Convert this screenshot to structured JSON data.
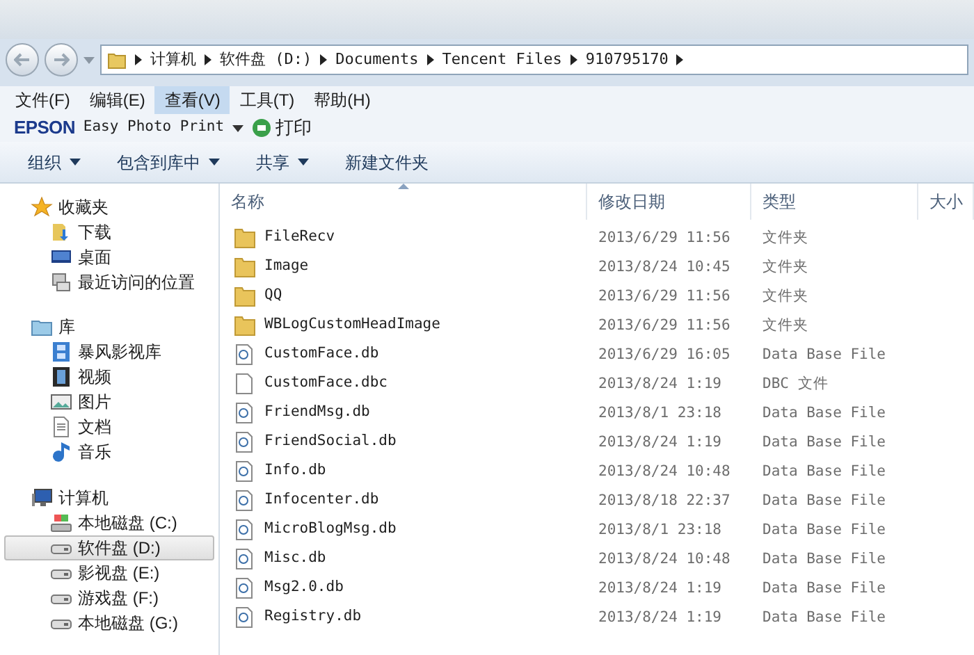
{
  "address_bar": {
    "path": [
      "计算机",
      "软件盘 (D:)",
      "Documents",
      "Tencent Files",
      "910795170"
    ]
  },
  "menu": [
    {
      "label": "文件(F)",
      "selected": false
    },
    {
      "label": "编辑(E)",
      "selected": false
    },
    {
      "label": "查看(V)",
      "selected": true
    },
    {
      "label": "工具(T)",
      "selected": false
    },
    {
      "label": "帮助(H)",
      "selected": false
    }
  ],
  "epson_bar": {
    "brand": "EPSON",
    "app": "Easy Photo Print",
    "print": "打印"
  },
  "toolbar": [
    "组织",
    "包含到库中",
    "共享",
    "新建文件夹"
  ],
  "sidebar": {
    "groups": [
      {
        "label": "收藏夹",
        "kind": "favorites",
        "children": [
          {
            "label": "下载",
            "kind": "download",
            "selected": false
          },
          {
            "label": "桌面",
            "kind": "desktop",
            "selected": false
          },
          {
            "label": "最近访问的位置",
            "kind": "recent",
            "selected": false
          }
        ]
      },
      {
        "label": "库",
        "kind": "library",
        "children": [
          {
            "label": "暴风影视库",
            "kind": "film",
            "selected": false
          },
          {
            "label": "视频",
            "kind": "video",
            "selected": false
          },
          {
            "label": "图片",
            "kind": "picture",
            "selected": false
          },
          {
            "label": "文档",
            "kind": "document",
            "selected": false
          },
          {
            "label": "音乐",
            "kind": "music",
            "selected": false
          }
        ]
      },
      {
        "label": "计算机",
        "kind": "computer",
        "children": [
          {
            "label": "本地磁盘 (C:)",
            "kind": "system-drive",
            "selected": false
          },
          {
            "label": "软件盘 (D:)",
            "kind": "drive",
            "selected": true
          },
          {
            "label": "影视盘 (E:)",
            "kind": "drive",
            "selected": false
          },
          {
            "label": "游戏盘 (F:)",
            "kind": "drive",
            "selected": false
          },
          {
            "label": "本地磁盘 (G:)",
            "kind": "drive",
            "selected": false
          }
        ]
      }
    ]
  },
  "table": {
    "columns": [
      "名称",
      "修改日期",
      "类型",
      "大小"
    ],
    "rows": [
      {
        "kind": "folder",
        "name": "FileRecv",
        "date": "2013/6/29 11:56",
        "type": "文件夹"
      },
      {
        "kind": "folder",
        "name": "Image",
        "date": "2013/8/24 10:45",
        "type": "文件夹"
      },
      {
        "kind": "folder",
        "name": "QQ",
        "date": "2013/6/29 11:56",
        "type": "文件夹"
      },
      {
        "kind": "folder",
        "name": "WBLogCustomHeadImage",
        "date": "2013/6/29 11:56",
        "type": "文件夹"
      },
      {
        "kind": "db",
        "name": "CustomFace.db",
        "date": "2013/6/29 16:05",
        "type": "Data Base File"
      },
      {
        "kind": "file",
        "name": "CustomFace.dbc",
        "date": "2013/8/24 1:19",
        "type": "DBC 文件"
      },
      {
        "kind": "db",
        "name": "FriendMsg.db",
        "date": "2013/8/1 23:18",
        "type": "Data Base File"
      },
      {
        "kind": "db",
        "name": "FriendSocial.db",
        "date": "2013/8/24 1:19",
        "type": "Data Base File"
      },
      {
        "kind": "db",
        "name": "Info.db",
        "date": "2013/8/24 10:48",
        "type": "Data Base File"
      },
      {
        "kind": "db",
        "name": "Infocenter.db",
        "date": "2013/8/18 22:37",
        "type": "Data Base File"
      },
      {
        "kind": "db",
        "name": "MicroBlogMsg.db",
        "date": "2013/8/1 23:18",
        "type": "Data Base File"
      },
      {
        "kind": "db",
        "name": "Misc.db",
        "date": "2013/8/24 10:48",
        "type": "Data Base File"
      },
      {
        "kind": "db",
        "name": "Msg2.0.db",
        "date": "2013/8/24 1:19",
        "type": "Data Base File"
      },
      {
        "kind": "db",
        "name": "Registry.db",
        "date": "2013/8/24 1:19",
        "type": "Data Base File"
      }
    ]
  }
}
